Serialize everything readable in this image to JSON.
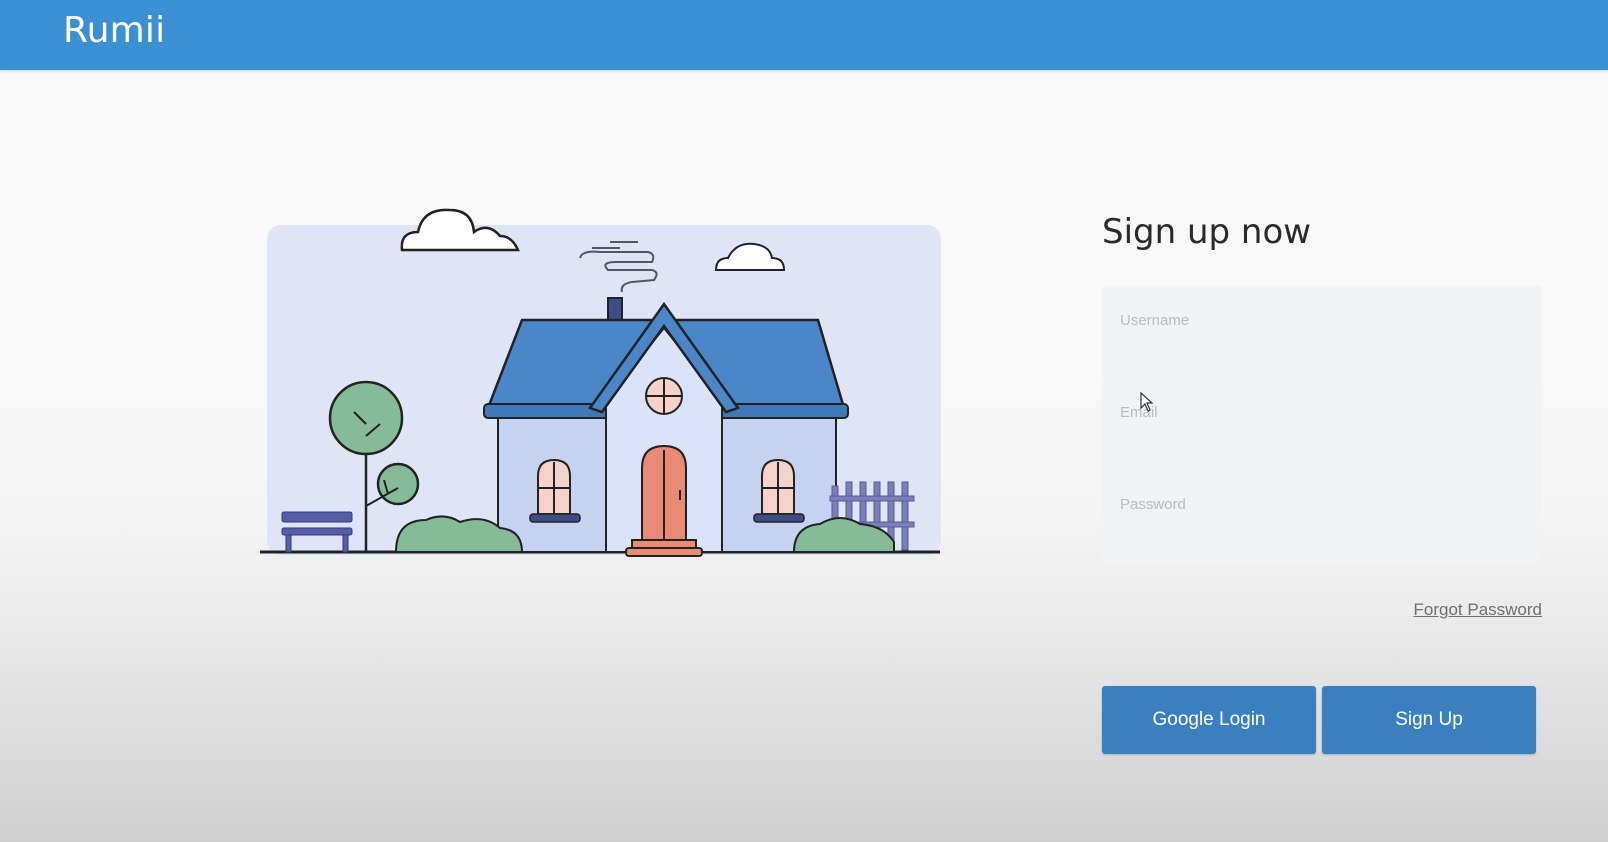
{
  "header": {
    "brand": "Rumii",
    "color": "#3b8fd3"
  },
  "illustration": {
    "icon": "house-illustration"
  },
  "form": {
    "title": "Sign up now",
    "username_placeholder": "Username",
    "email_placeholder": "Email",
    "password_placeholder": "Password",
    "forgot_password": "Forgot Password",
    "google_login_label": "Google Login",
    "signup_label": "Sign Up",
    "button_color": "#3a80c0"
  }
}
